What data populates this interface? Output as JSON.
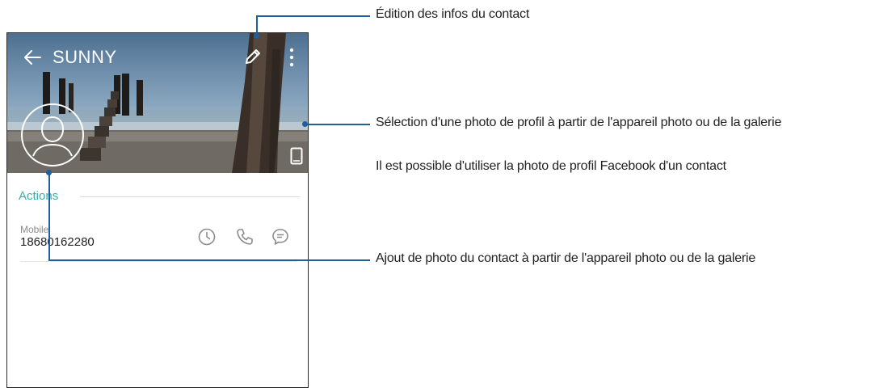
{
  "contact": {
    "name": "SUNNY",
    "section_label": "Actions",
    "phone_type": "Mobile",
    "phone_number": "18680162280"
  },
  "icons": {
    "back": "arrow-left-icon",
    "edit": "pencil-icon",
    "more": "overflow-menu-icon",
    "avatar": "person-placeholder-icon",
    "device": "phone-device-icon",
    "history": "clock-icon",
    "call": "phone-call-icon",
    "message": "message-bubble-icon"
  },
  "colors": {
    "accent": "#33b1a5",
    "callout": "#1f5f9e"
  },
  "callouts": {
    "edit_info": "Édition des infos du contact",
    "select_photo": "Sélection d'une photo de profil à partir de l'appareil photo ou de la galerie",
    "facebook_photo": "Il est possible d'utiliser la photo de profil Facebook d'un contact",
    "add_photo": "Ajout de photo du contact à partir de l'appareil photo ou de la galerie"
  }
}
